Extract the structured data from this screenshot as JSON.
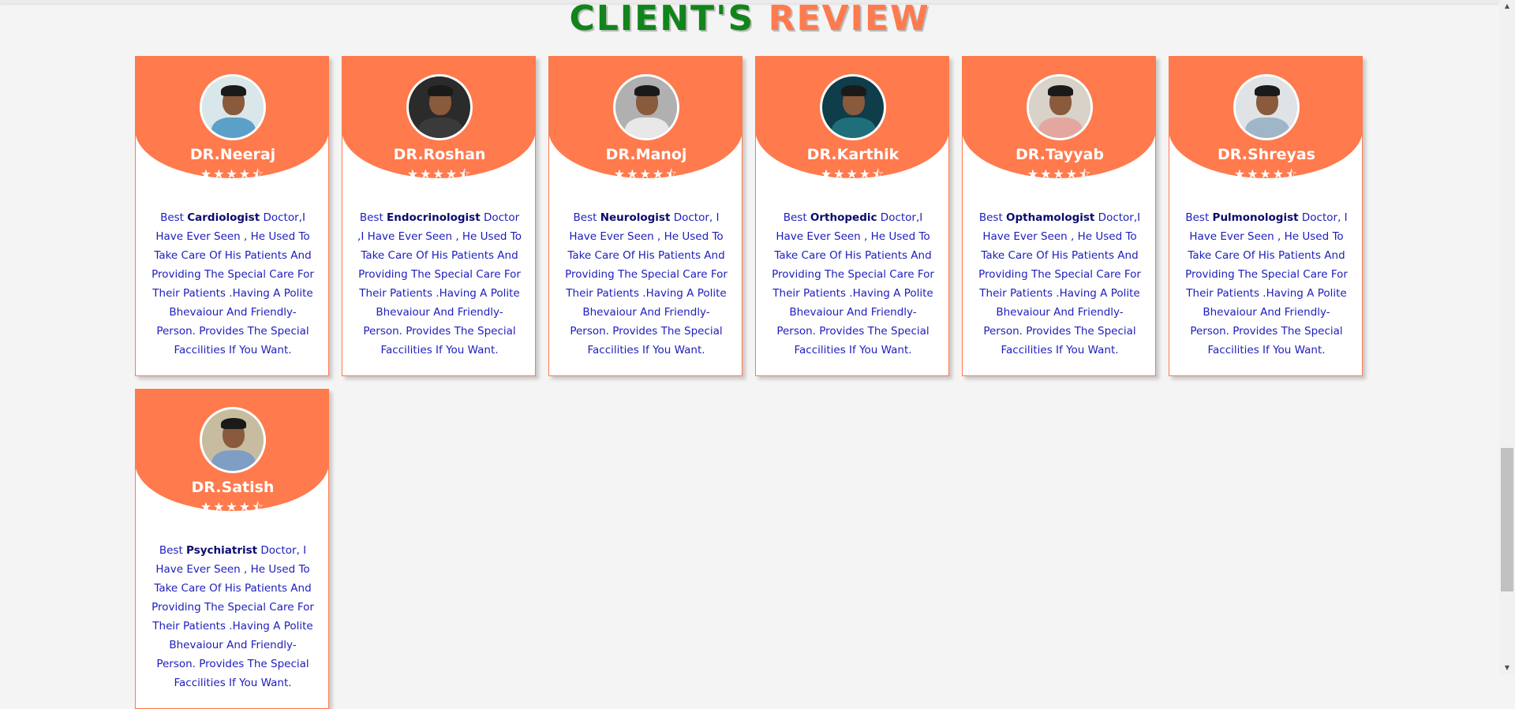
{
  "section_title": {
    "word1": "CLIENT'S",
    "word2": "REVIEW"
  },
  "colors": {
    "accent": "#ff7a4d",
    "title_green": "#11841b",
    "text_blue": "#1d1dbd"
  },
  "review_template": {
    "prefix": "Best ",
    "body": " Have Ever Seen , He Used To Take Care Of His Patients And Providing The Special Care For Their Patients .Having A Polite Bhevaiour And Friendly-Person. Provides The Special Faccilities If You Want."
  },
  "cards": [
    {
      "name": "DR.Neeraj",
      "specialty": "Cardiologist",
      "after": " Doctor,I",
      "rating": 4.5,
      "stars": "★★★★⯪",
      "shirt": "#5aa0c8",
      "bg": "#d9e6ea"
    },
    {
      "name": "DR.Roshan",
      "specialty": "Endocrinologist",
      "after": " Doctor ,I",
      "rating": 4.5,
      "stars": "★★★★⯪",
      "shirt": "#3a3a3a",
      "bg": "#2b2b2b"
    },
    {
      "name": "DR.Manoj",
      "specialty": "Neurologist",
      "after": " Doctor, I",
      "rating": 4.5,
      "stars": "★★★★⯪",
      "shirt": "#e8e8e8",
      "bg": "#b0b0b0"
    },
    {
      "name": "DR.Karthik",
      "specialty": "Orthopedic",
      "after": " Doctor,I",
      "rating": 4.5,
      "stars": "★★★★⯪",
      "shirt": "#1f6f7a",
      "bg": "#0f3d4a"
    },
    {
      "name": "DR.Tayyab",
      "specialty": "Opthamologist",
      "after": " Doctor,I",
      "rating": 4.5,
      "stars": "★★★★⯪",
      "shirt": "#e3a7a0",
      "bg": "#d8d2c8"
    },
    {
      "name": "DR.Shreyas",
      "specialty": "Pulmonologist",
      "after": " Doctor, I",
      "rating": 4.5,
      "stars": "★★★★⯪",
      "shirt": "#9fb6c8",
      "bg": "#dfe3e6"
    },
    {
      "name": "DR.Satish",
      "specialty": "Psychiatrist",
      "after": " Doctor, I",
      "rating": 4.5,
      "stars": "★★★★⯪",
      "shirt": "#7f9ec4",
      "bg": "#c8bca0"
    }
  ]
}
